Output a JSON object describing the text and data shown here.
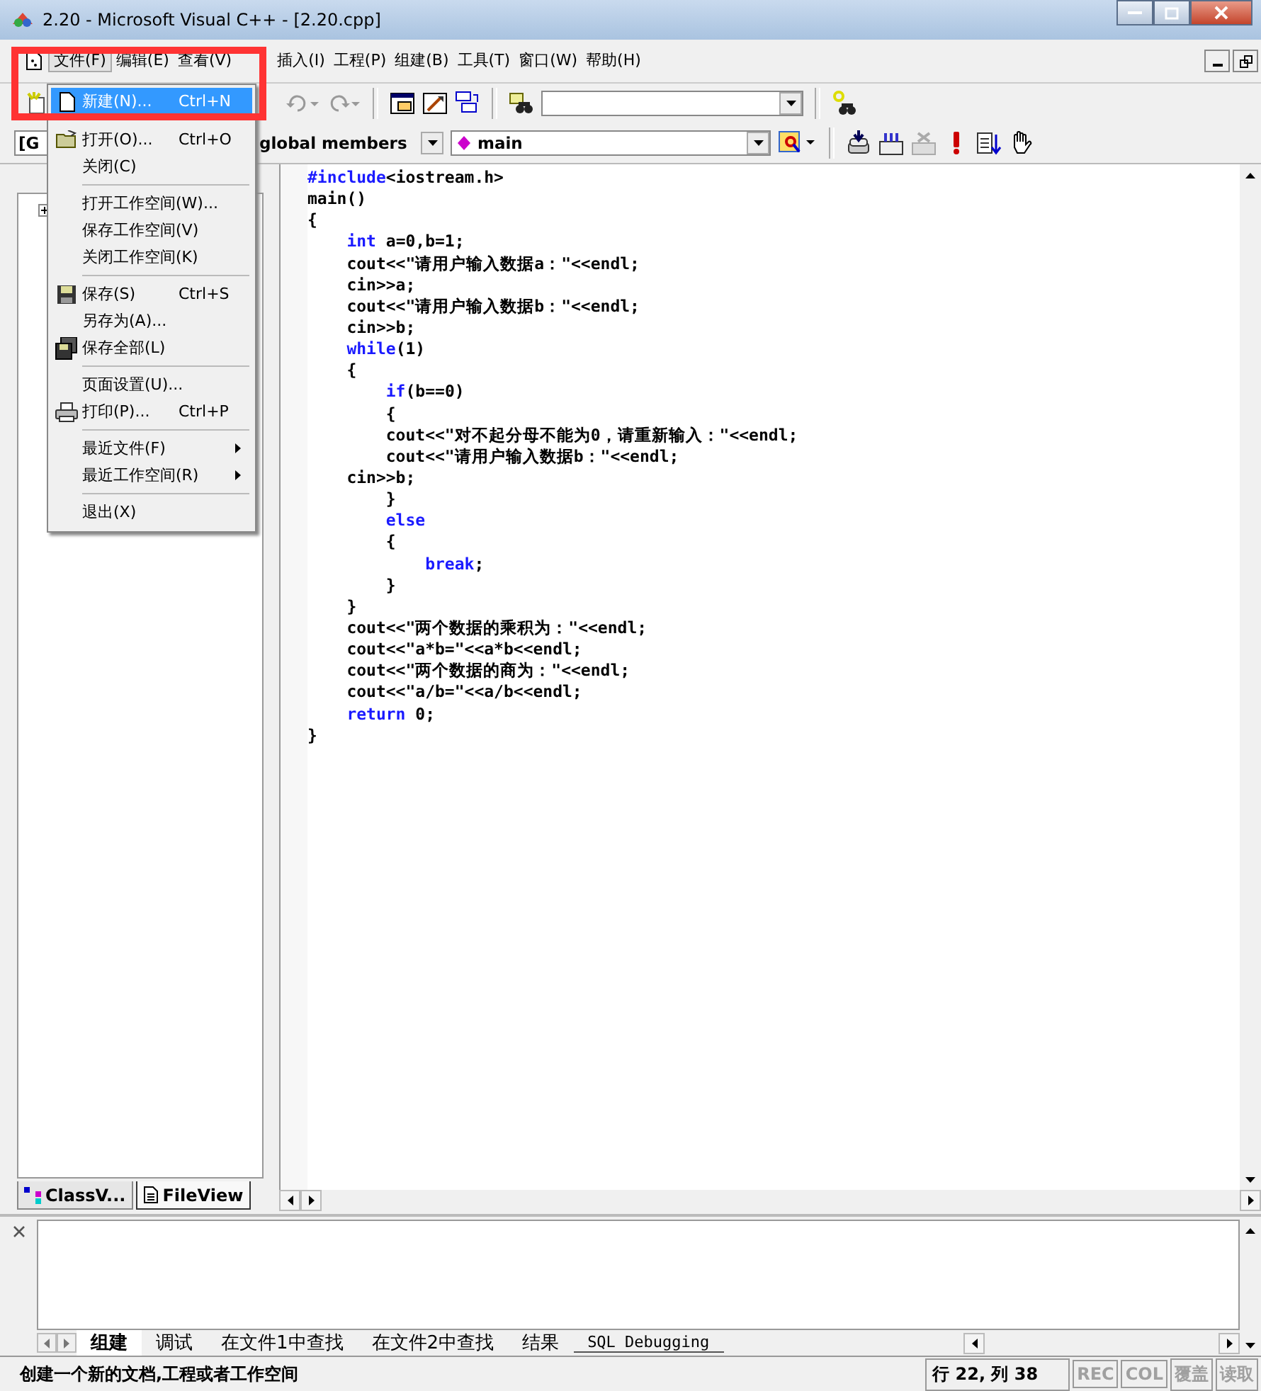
{
  "window": {
    "title": "2.20 - Microsoft Visual C++ - [2.20.cpp]"
  },
  "menu_bar": [
    {
      "label": "文件(F)",
      "selected": true
    },
    {
      "label": "编辑(E)",
      "selected": false
    },
    {
      "label": "查看(V)",
      "selected": false
    },
    {
      "label": "插入(I)",
      "selected": false
    },
    {
      "label": "工程(P)",
      "selected": false
    },
    {
      "label": "组建(B)",
      "selected": false
    },
    {
      "label": "工具(T)",
      "selected": false
    },
    {
      "label": "窗口(W)",
      "selected": false
    },
    {
      "label": "帮助(H)",
      "selected": false
    }
  ],
  "file_menu": [
    {
      "kind": "item",
      "label": "新建(N)...",
      "shortcut": "Ctrl+N",
      "selected": true
    },
    {
      "kind": "item",
      "label": "打开(O)...",
      "shortcut": "Ctrl+O",
      "selected": false
    },
    {
      "kind": "item",
      "label": "关闭(C)",
      "selected": false
    },
    {
      "kind": "separator"
    },
    {
      "kind": "item",
      "label": "打开工作空间(W)...",
      "selected": false
    },
    {
      "kind": "item",
      "label": "保存工作空间(V)",
      "selected": false
    },
    {
      "kind": "item",
      "label": "关闭工作空间(K)",
      "selected": false
    },
    {
      "kind": "separator"
    },
    {
      "kind": "item",
      "label": "保存(S)",
      "shortcut": "Ctrl+S",
      "selected": false
    },
    {
      "kind": "item",
      "label": "另存为(A)...",
      "selected": false
    },
    {
      "kind": "item",
      "label": "保存全部(L)",
      "selected": false
    },
    {
      "kind": "separator"
    },
    {
      "kind": "item",
      "label": "页面设置(U)...",
      "selected": false
    },
    {
      "kind": "item",
      "label": "打印(P)...",
      "shortcut": "Ctrl+P",
      "selected": false
    },
    {
      "kind": "separator"
    },
    {
      "kind": "submenu",
      "label": "最近文件(F)",
      "selected": false
    },
    {
      "kind": "submenu",
      "label": "最近工作空间(R)",
      "selected": false
    },
    {
      "kind": "separator"
    },
    {
      "kind": "item",
      "label": "退出(X)",
      "selected": false
    }
  ],
  "wizard_bar": {
    "class_combo": "[G",
    "filter_combo": "global members",
    "member_combo": "main"
  },
  "workspace_tabs": [
    {
      "label": "ClassV...",
      "selected": false
    },
    {
      "label": "FileView",
      "selected": true
    }
  ],
  "code": [
    [
      {
        "text": "#include",
        "keyword": true
      },
      {
        "text": "<iostream.h>",
        "keyword": false
      }
    ],
    [
      {
        "text": "main()",
        "keyword": false
      }
    ],
    [
      {
        "text": "{",
        "keyword": false
      }
    ],
    [
      {
        "text": "    int",
        "keyword": true
      },
      {
        "text": " a=0,b=1;",
        "keyword": false
      }
    ],
    [
      {
        "text": "    cout<<\"请用户输入数据a：\"<<endl;",
        "keyword": false
      }
    ],
    [
      {
        "text": "    cin>>a;",
        "keyword": false
      }
    ],
    [
      {
        "text": "    cout<<\"请用户输入数据b：\"<<endl;",
        "keyword": false
      }
    ],
    [
      {
        "text": "    cin>>b;",
        "keyword": false
      }
    ],
    [
      {
        "text": "    while",
        "keyword": true
      },
      {
        "text": "(1)",
        "keyword": false
      }
    ],
    [
      {
        "text": "    {",
        "keyword": false
      }
    ],
    [
      {
        "text": "        if",
        "keyword": true
      },
      {
        "text": "(b==0)",
        "keyword": false
      }
    ],
    [
      {
        "text": "        {",
        "keyword": false
      }
    ],
    [
      {
        "text": "        cout<<\"对不起分母不能为0，请重新输入：\"<<endl;",
        "keyword": false
      }
    ],
    [
      {
        "text": "        cout<<\"请用户输入数据b：\"<<endl;",
        "keyword": false
      }
    ],
    [
      {
        "text": "    cin>>b;",
        "keyword": false
      }
    ],
    [
      {
        "text": "        }",
        "keyword": false
      }
    ],
    [
      {
        "text": "        else",
        "keyword": true
      }
    ],
    [
      {
        "text": "        {",
        "keyword": false
      }
    ],
    [
      {
        "text": "            break",
        "keyword": true
      },
      {
        "text": ";",
        "keyword": false
      }
    ],
    [
      {
        "text": "        }",
        "keyword": false
      }
    ],
    [
      {
        "text": "    }",
        "keyword": false
      }
    ],
    [
      {
        "text": "    cout<<\"两个数据的乘积为：\"<<endl;",
        "keyword": false
      }
    ],
    [
      {
        "text": "    cout<<\"a*b=\"<<a*b<<endl;",
        "keyword": false
      }
    ],
    [
      {
        "text": "    cout<<\"两个数据的商为：\"<<endl;",
        "keyword": false
      }
    ],
    [
      {
        "text": "    cout<<\"a/b=\"<<a/b<<endl;",
        "keyword": false
      }
    ],
    [
      {
        "text": "    return",
        "keyword": true
      },
      {
        "text": " 0;",
        "keyword": false
      }
    ],
    [
      {
        "text": "}",
        "keyword": false
      }
    ]
  ],
  "output_tabs": [
    {
      "label": "组建",
      "selected": true
    },
    {
      "label": "调试",
      "selected": false
    },
    {
      "label": "在文件1中查找",
      "selected": false
    },
    {
      "label": "在文件2中查找",
      "selected": false
    },
    {
      "label": "结果",
      "selected": false
    },
    {
      "label": "SQL Debugging",
      "selected": false
    }
  ],
  "status_bar": {
    "message": "创建一个新的文档,工程或者工作空间",
    "position": "行 22, 列 38",
    "indicators": [
      {
        "label": "REC",
        "disabled": true
      },
      {
        "label": "COL",
        "disabled": true
      },
      {
        "label": "覆盖",
        "disabled": true
      },
      {
        "label": "读取",
        "disabled": true
      }
    ]
  }
}
